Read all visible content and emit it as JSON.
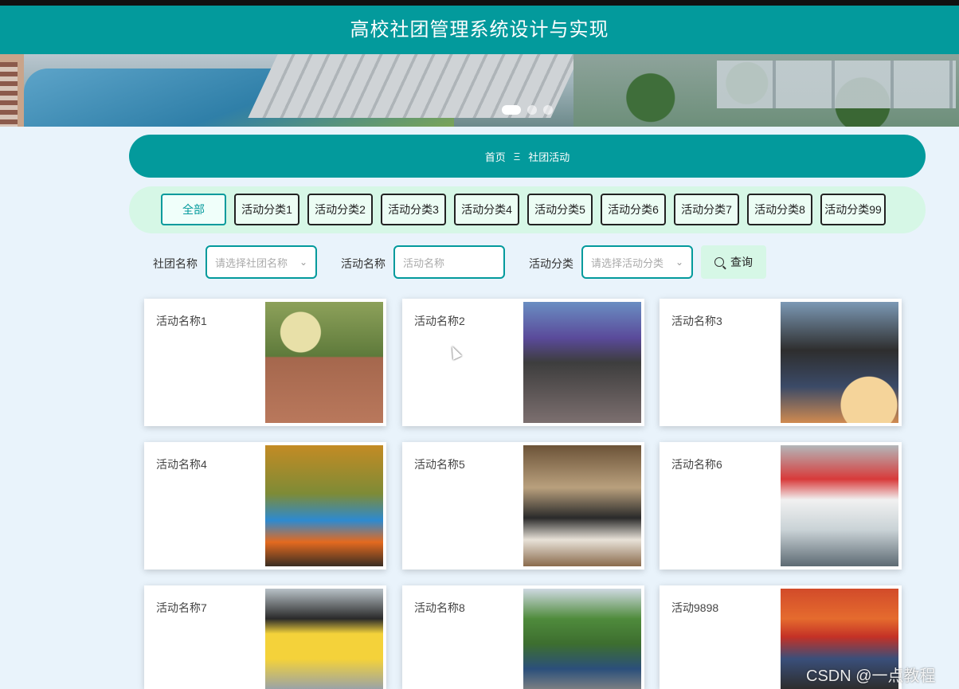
{
  "header": {
    "title": "高校社团管理系统设计与实现"
  },
  "banner": {
    "slides": 3,
    "active_slide": 1
  },
  "breadcrumb": {
    "home": "首页",
    "separator": "Ξ",
    "current": "社团活动"
  },
  "categories": [
    "全部",
    "活动分类1",
    "活动分类2",
    "活动分类3",
    "活动分类4",
    "活动分类5",
    "活动分类6",
    "活动分类7",
    "活动分类8",
    "活动分类99"
  ],
  "filters": {
    "club_label": "社团名称",
    "club_placeholder": "请选择社团名称",
    "activity_label": "活动名称",
    "activity_placeholder": "活动名称",
    "category_label": "活动分类",
    "category_placeholder": "请选择活动分类",
    "query_button": "查询"
  },
  "cards": [
    {
      "title": "活动名称1"
    },
    {
      "title": "活动名称2"
    },
    {
      "title": "活动名称3"
    },
    {
      "title": "活动名称4"
    },
    {
      "title": "活动名称5"
    },
    {
      "title": "活动名称6"
    },
    {
      "title": "活动名称7"
    },
    {
      "title": "活动名称8"
    },
    {
      "title": "活动9898"
    }
  ],
  "watermark": "CSDN @一点教程",
  "colors": {
    "primary": "#039a9c",
    "mint": "#d6f7e6",
    "background": "#e9f3fb"
  }
}
